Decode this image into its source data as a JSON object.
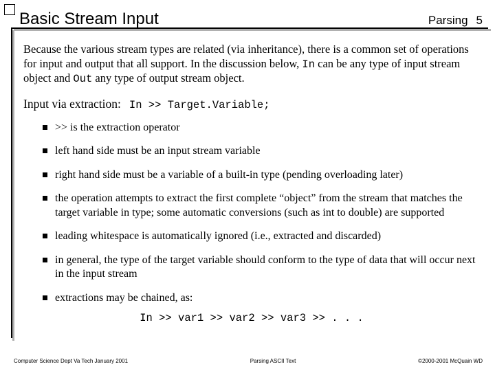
{
  "header": {
    "title": "Basic Stream Input",
    "section": "Parsing",
    "page": "5"
  },
  "intro": {
    "part1": "Because the various stream types are related (via inheritance), there is a common set of operations for input and output that all support.  In the discussion below, ",
    "code1": "In",
    "part2": " can be any type of input stream object and ",
    "code2": "Out",
    "part3": " any type of output stream object."
  },
  "subhead": {
    "label": "Input via extraction:",
    "code": "In >> Target.Variable;"
  },
  "bullets": [
    ">> is the extraction operator",
    "left hand side must be an input stream variable",
    "right hand side must be a variable of a built-in type (pending overloading later)",
    "the operation attempts to extract the first complete “object” from the stream that matches the target variable in type; some automatic conversions (such as int to double) are supported",
    "leading whitespace is automatically ignored (i.e., extracted and discarded)",
    "in general, the type of the target variable should conform to the type of data that will occur next in the input stream",
    "extractions may be chained, as:"
  ],
  "chain_code": "In >> var1 >> var2 >> var3 >> . . .",
  "footer": {
    "left": "Computer Science Dept Va Tech January 2001",
    "center": "Parsing ASCII Text",
    "right": "©2000-2001  McQuain WD"
  }
}
